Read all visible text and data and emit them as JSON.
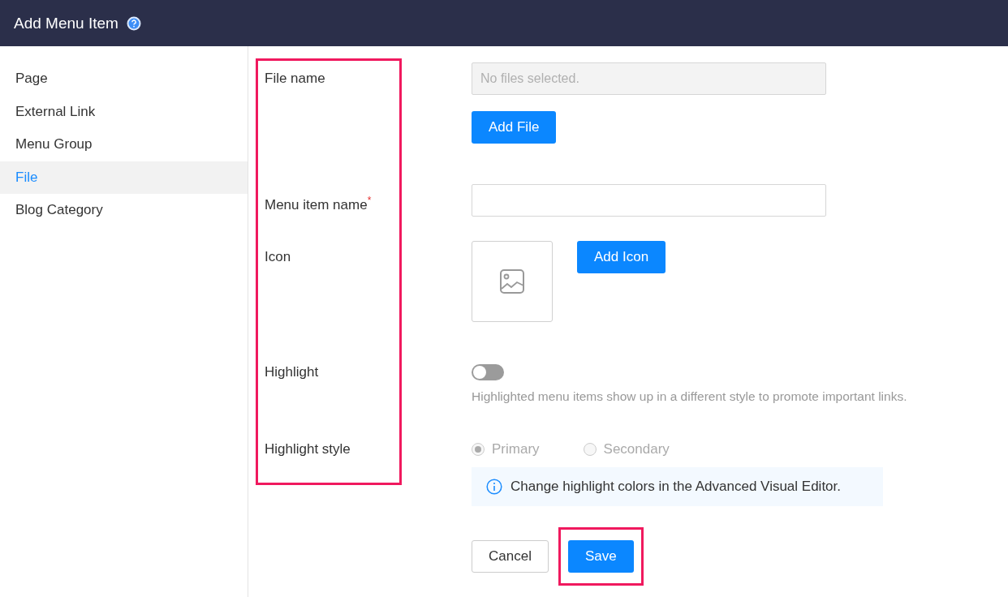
{
  "header": {
    "title": "Add Menu Item"
  },
  "sidebar": {
    "items": [
      {
        "label": "Page",
        "selected": false
      },
      {
        "label": "External Link",
        "selected": false
      },
      {
        "label": "Menu Group",
        "selected": false
      },
      {
        "label": "File",
        "selected": true
      },
      {
        "label": "Blog Category",
        "selected": false
      }
    ]
  },
  "form": {
    "file_name": {
      "label": "File name",
      "placeholder": "No files selected.",
      "button": "Add File"
    },
    "menu_item_name": {
      "label": "Menu item name$^{*}$"
    },
    "icon": {
      "label": "Icon",
      "button": "Add Icon"
    },
    "highlight": {
      "label": "Highlight",
      "on": false,
      "description": "Highlighted menu items show up in a different style to promote important links."
    },
    "highlight_style": {
      "label": "Highlight style",
      "disabled": true,
      "options": [
        {
          "label": "Primary",
          "selected": true
        },
        {
          "label": "Secondary",
          "selected": false
        }
      ],
      "info": "Change highlight colors in the Advanced Visual Editor."
    }
  },
  "buttons": [
    {
      "label": "Cancel",
      "kind": "secondary"
    },
    {
      "label": "Save",
      "kind": "primary"
    }
  ]
}
